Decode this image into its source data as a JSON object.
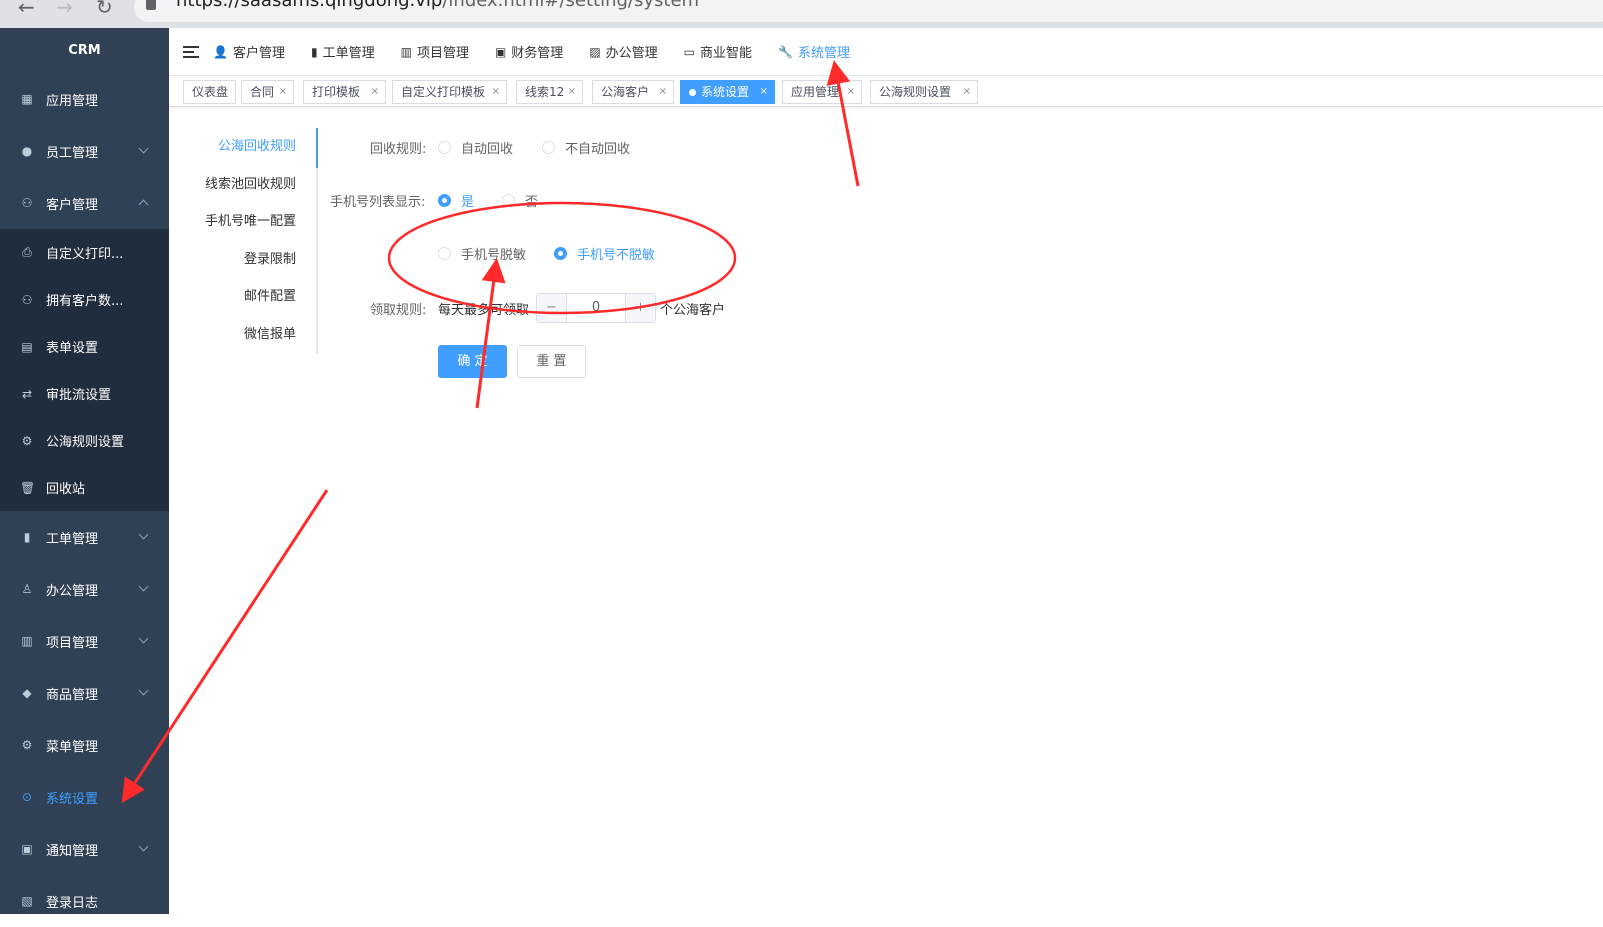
{
  "browser": {
    "url_main": "https://saasams.qingdong.vip",
    "url_path": "/index.html#/setting/system"
  },
  "sidebar": {
    "brand": "CRM",
    "items": [
      {
        "label": "应用管理",
        "icon": "grid-icon"
      },
      {
        "label": "员工管理",
        "icon": "user-icon"
      },
      {
        "label": "客户管理",
        "icon": "users-icon"
      }
    ],
    "sub_items": [
      {
        "label": "自定义打印...",
        "icon": "printer-icon"
      },
      {
        "label": "拥有客户数...",
        "icon": "users-icon"
      },
      {
        "label": "表单设置",
        "icon": "form-icon"
      },
      {
        "label": "审批流设置",
        "icon": "flow-icon"
      },
      {
        "label": "公海规则设置",
        "icon": "settings-icon"
      },
      {
        "label": "回收站",
        "icon": "trash-icon"
      }
    ],
    "items_bottom": [
      {
        "label": "工单管理",
        "icon": "clipboard-icon"
      },
      {
        "label": "办公管理",
        "icon": "stamp-icon"
      },
      {
        "label": "项目管理",
        "icon": "columns-icon"
      },
      {
        "label": "商品管理",
        "icon": "box-icon"
      },
      {
        "label": "菜单管理",
        "icon": "gear-icon"
      },
      {
        "label": "系统设置",
        "icon": "settings-icon"
      },
      {
        "label": "通知管理",
        "icon": "bell-icon"
      },
      {
        "label": "登录日志",
        "icon": "log-icon"
      }
    ]
  },
  "topnav": {
    "items": [
      {
        "label": "客户管理",
        "icon": "person-icon"
      },
      {
        "label": "工单管理",
        "icon": "clipboard-icon"
      },
      {
        "label": "项目管理",
        "icon": "columns-icon"
      },
      {
        "label": "财务管理",
        "icon": "finance-icon"
      },
      {
        "label": "办公管理",
        "icon": "office-icon"
      },
      {
        "label": "商业智能",
        "icon": "monitor-icon"
      },
      {
        "label": "系统管理",
        "icon": "wrench-icon"
      }
    ]
  },
  "tags": [
    {
      "label": "仪表盘",
      "closable": false
    },
    {
      "label": "合同",
      "closable": true
    },
    {
      "label": "打印模板",
      "closable": true
    },
    {
      "label": "自定义打印模板",
      "closable": true
    },
    {
      "label": "线索12",
      "closable": true
    },
    {
      "label": "公海客户",
      "closable": true
    },
    {
      "label": "系统设置",
      "closable": true
    },
    {
      "label": "应用管理",
      "closable": true
    },
    {
      "label": "公海规则设置",
      "closable": true
    }
  ],
  "subnav": {
    "items": [
      "公海回收规则",
      "线索池回收规则",
      "手机号唯一配置",
      "登录限制",
      "邮件配置",
      "微信报单"
    ]
  },
  "form": {
    "recycle_label": "回收规则:",
    "recycle_options": [
      "自动回收",
      "不自动回收"
    ],
    "phone_label": "手机号列表显示:",
    "phone_options": [
      "是",
      "否"
    ],
    "mask_options": [
      "手机号脱敏",
      "手机号不脱敏"
    ],
    "claim_label": "领取规则:",
    "claim_prefix": "每天最多可领取",
    "claim_value": "0",
    "claim_suffix": "个公海客户",
    "minus": "−",
    "plus": "+",
    "confirm": "确 定",
    "reset": "重 置"
  },
  "theme": {
    "accent": "#409eff",
    "sidebar_bg": "#304156",
    "annotation": "#ff2a2a"
  }
}
